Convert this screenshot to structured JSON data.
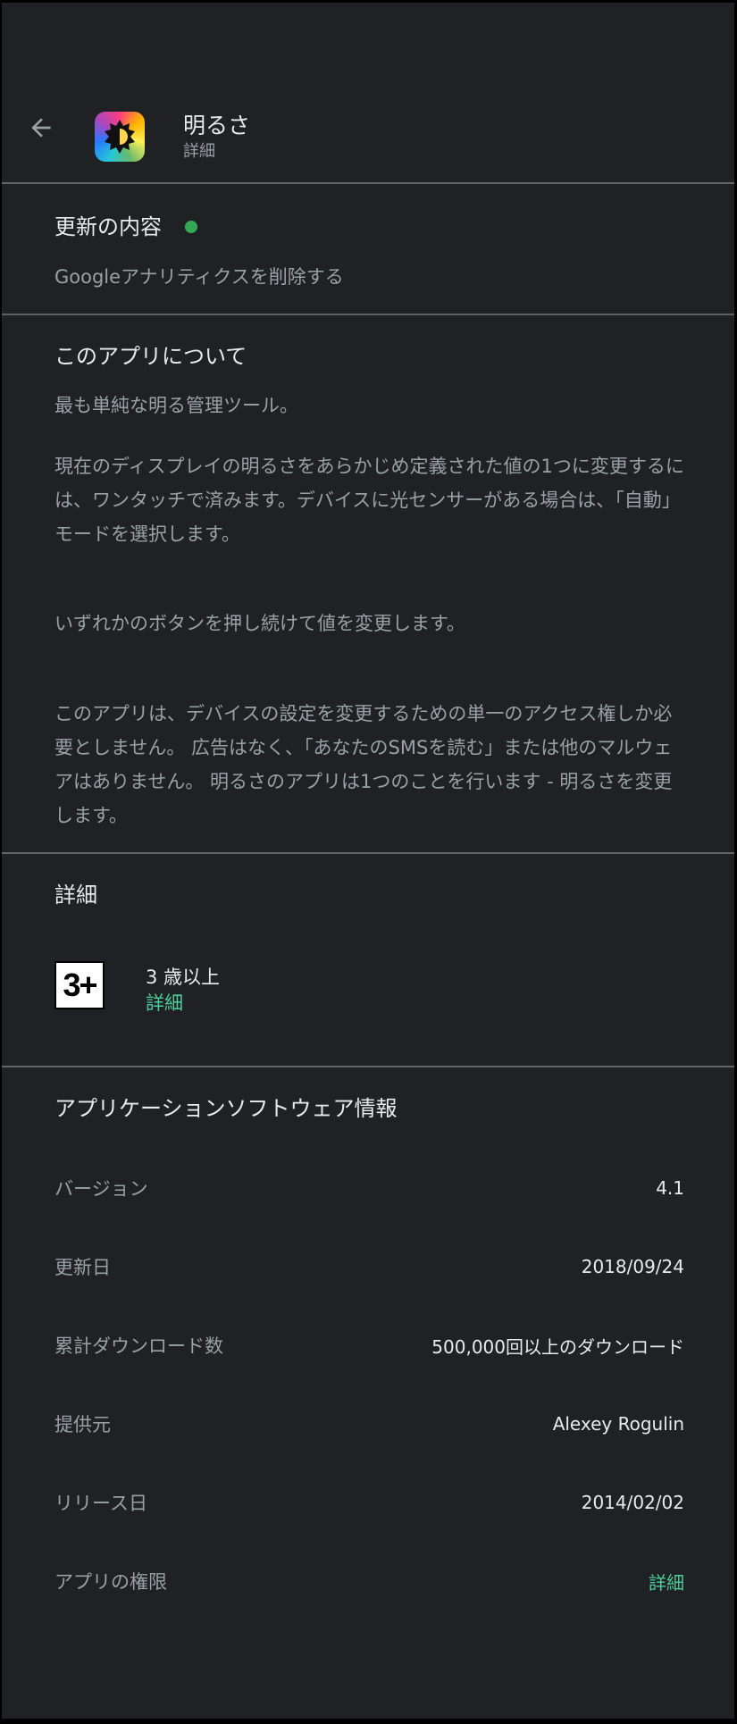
{
  "header": {
    "title": "明るさ",
    "subtitle": "詳細",
    "back_icon": "arrow-left-icon",
    "app_icon": "brightness-app-icon"
  },
  "whats_new": {
    "title": "更新の内容",
    "text": "Googleアナリティクスを削除する",
    "dot_color": "#34a853"
  },
  "about": {
    "title": "このアプリについて",
    "paragraphs": [
      "最も単純な明る管理ツール。",
      "現在のディスプレイの明るさをあらかじめ定義された値の1つに変更するには、ワンタッチで済みます。デバイスに光センサーがある場合は、「自動」モードを選択します。",
      "いずれかのボタンを押し続けて値を変更します。",
      "このアプリは、デバイスの設定を変更するための単一のアクセス権しか必要としません。 広告はなく、「あなたのSMSを読む」または他のマルウェアはありません。 明るさのアプリは1つのことを行います - 明るさを変更します。"
    ]
  },
  "details": {
    "title": "詳細",
    "rating_badge": "3+",
    "rating_label": "3 歳以上",
    "rating_link": "詳細"
  },
  "app_info": {
    "title": "アプリケーションソフトウェア情報",
    "rows": [
      {
        "label": "バージョン",
        "value": "4.1"
      },
      {
        "label": "更新日",
        "value": "2018/09/24"
      },
      {
        "label": "累計ダウンロード数",
        "value": "500,000回以上のダウンロード"
      },
      {
        "label": "提供元",
        "value": "Alexey Rogulin"
      },
      {
        "label": "リリース日",
        "value": "2014/02/02"
      },
      {
        "label": "アプリの権限",
        "value": "詳細"
      }
    ]
  },
  "colors": {
    "background": "#202124",
    "divider": "#5f6368",
    "accent": "#4ccf9a",
    "primary_text": "#e8eaed",
    "secondary_text": "#9aa0a6"
  }
}
